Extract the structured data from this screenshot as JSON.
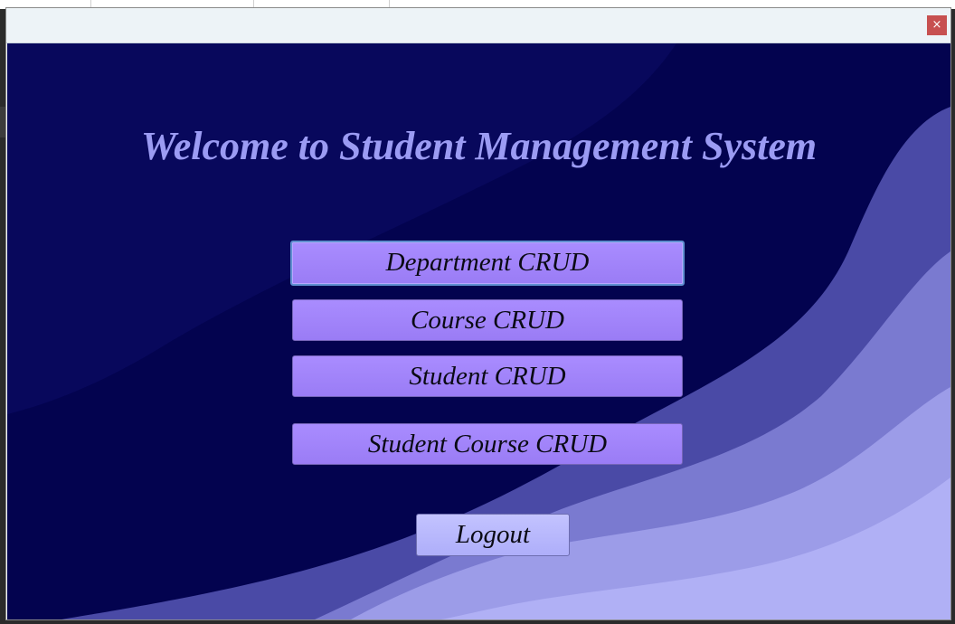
{
  "window": {
    "close_glyph": "×"
  },
  "page": {
    "title": "Welcome to Student Management System"
  },
  "buttons": {
    "department": "Department CRUD",
    "course": "Course CRUD",
    "student": "Student CRUD",
    "student_course": "Student Course CRUD",
    "logout": "Logout"
  },
  "colors": {
    "background": "#03034f",
    "title": "#9b9bf3",
    "crud_button": "#a98cff",
    "logout_button": "#c3c3ff",
    "close_button": "#c75050"
  }
}
